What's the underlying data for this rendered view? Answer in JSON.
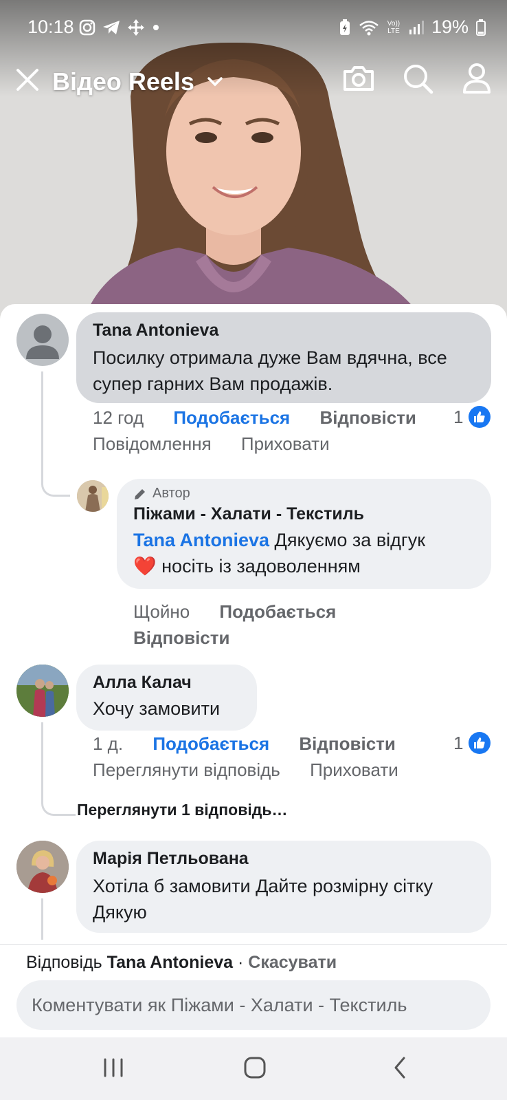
{
  "status_bar": {
    "time": "10:18",
    "battery": "19%",
    "left_icons": [
      "instagram-icon",
      "telegram-icon",
      "move-icon",
      "dot-icon"
    ],
    "right_icons": [
      "battery-saver-icon",
      "wifi-icon",
      "volte-icon",
      "signal-icon",
      "battery-icon"
    ],
    "volte_label": "Vo)) LTE"
  },
  "top_nav": {
    "title": "Відео Reels",
    "icons": [
      "close-icon",
      "chevron-down-icon",
      "camera-icon",
      "search-icon",
      "user-icon"
    ]
  },
  "comments": [
    {
      "author": "Tana Antonieva",
      "text": "Посилку отримала дуже Вам вдячна, все супер гарних Вам продажів.",
      "time": "12 год",
      "like_label": "Подобається",
      "reply_label": "Відповісти",
      "likes": "1",
      "message_label": "Повідомлення",
      "hide_label": "Приховати",
      "reply": {
        "badge": "Автор",
        "author": "Піжами - Халати - Текстиль",
        "mention": "Tana Antonieva",
        "text_part1": "Дякуємо за відгук",
        "emoji": "❤️",
        "text_part2": "носіть із задоволенням",
        "time": "Щойно",
        "like_label": "Подобається",
        "reply_label": "Відповісти"
      }
    },
    {
      "author": "Алла Калач",
      "text": "Хочу замовити",
      "time": "1 д.",
      "like_label": "Подобається",
      "reply_label": "Відповісти",
      "likes": "1",
      "view_reply_label": "Переглянути відповідь",
      "hide_label": "Приховати",
      "view_replies_link": "Переглянути 1 відповідь…"
    },
    {
      "author": "Марія Петльована",
      "text": "Хотіла б замовити Дайте розмірну сітку Дякую"
    }
  ],
  "composer": {
    "reply_prefix": "Відповідь",
    "reply_to": "Tana Antonieva",
    "separator": "·",
    "cancel_label": "Скасувати",
    "placeholder": "Коментувати як Піжами - Халати - Текстиль"
  },
  "colors": {
    "accent_blue": "#1b74e4",
    "like_blue": "#1877f2",
    "bubble_bg": "#eef0f3",
    "bubble_highlight": "#d6d8dc",
    "muted_text": "#65676b"
  }
}
